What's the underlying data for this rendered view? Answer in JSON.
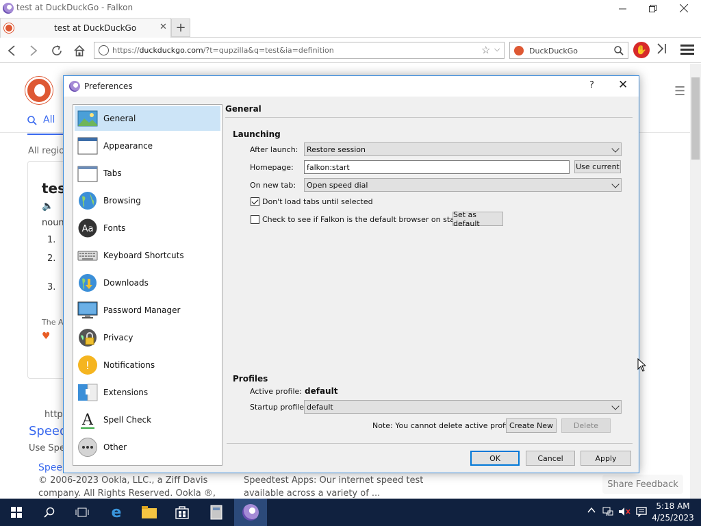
{
  "window": {
    "title": "test at DuckDuckGo - Falkon"
  },
  "tab": {
    "label": "test at DuckDuckGo",
    "close": "✕",
    "new_tab": "+"
  },
  "nav": {
    "url_prefix": "https://",
    "url_host": "duckduckgo.com",
    "url_rest": "/?t=qupzilla&q=test&ia=definition",
    "search_engine": "DuckDuckGo"
  },
  "page": {
    "all_tab": "All",
    "all_regions": "All region",
    "result_title": "tes",
    "noun": "noun",
    "list_nums": [
      "1.",
      "2.",
      "3."
    ],
    "attribution": "The A",
    "url_frag": "https",
    "speed_link": "Speed",
    "use_speed": "Use Spe",
    "speed2": "Spee",
    "copyright_1": "© 2006-2023 Ookla, LLC., a Ziff Davis",
    "copyright_2": "company. All Rights Reserved. Ookla ®,",
    "apps_1": "Speedtest Apps: Our internet speed test",
    "apps_2": "available across a variety of ...",
    "share_feedback": "Share Feedback"
  },
  "dialog": {
    "title": "Preferences",
    "help": "?",
    "close": "✕",
    "categories": [
      {
        "label": "General",
        "icon": "general-icon",
        "selected": true
      },
      {
        "label": "Appearance",
        "icon": "appearance-icon"
      },
      {
        "label": "Tabs",
        "icon": "tabs-icon"
      },
      {
        "label": "Browsing",
        "icon": "globe-icon"
      },
      {
        "label": "Fonts",
        "icon": "fonts-icon"
      },
      {
        "label": "Keyboard Shortcuts",
        "icon": "keyboard-icon"
      },
      {
        "label": "Downloads",
        "icon": "downloads-icon"
      },
      {
        "label": "Password Manager",
        "icon": "password-icon"
      },
      {
        "label": "Privacy",
        "icon": "privacy-icon"
      },
      {
        "label": "Notifications",
        "icon": "notifications-icon"
      },
      {
        "label": "Extensions",
        "icon": "extensions-icon"
      },
      {
        "label": "Spell Check",
        "icon": "spellcheck-icon"
      },
      {
        "label": "Other",
        "icon": "other-icon"
      }
    ],
    "general": {
      "header": "General",
      "launching": "Launching",
      "after_launch_label": "After launch:",
      "after_launch_value": "Restore session",
      "homepage_label": "Homepage:",
      "homepage_value": "falkon:start",
      "use_current": "Use current",
      "new_tab_label": "On new tab:",
      "new_tab_value": "Open speed dial",
      "dont_load_tabs": "Don't load tabs until selected",
      "dont_load_tabs_checked": true,
      "check_default": "Check to see if Falkon is the default browser on startup",
      "check_default_checked": false,
      "set_default": "Set as default",
      "profiles": "Profiles",
      "active_profile_label": "Active profile:",
      "active_profile_value": "default",
      "startup_profile_label": "Startup profile:",
      "startup_profile_value": "default",
      "note": "Note: You cannot delete active profile.",
      "create_new": "Create New",
      "delete": "Delete"
    },
    "buttons": {
      "ok": "OK",
      "cancel": "Cancel",
      "apply": "Apply"
    }
  },
  "taskbar": {
    "time": "5:18 AM",
    "date": "4/25/2023"
  },
  "colors": {
    "accent": "#0078d7",
    "selection": "#cce4f7",
    "taskbar": "#10213f",
    "ddg": "#de5833"
  }
}
